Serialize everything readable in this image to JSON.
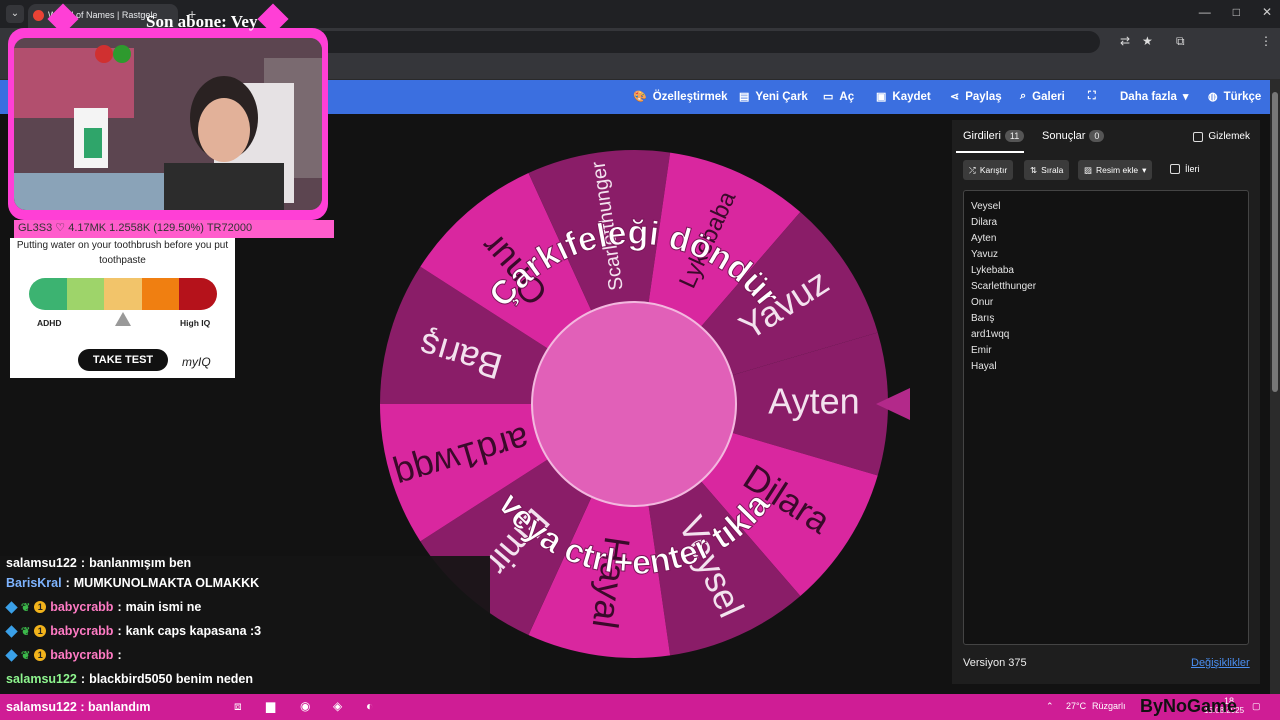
{
  "browser": {
    "tab_title": "Wheel of Names | Rastgele ad",
    "new_tab": "+"
  },
  "nav": {
    "items": [
      {
        "icon": "palette-icon",
        "label": "Özelleştirmek"
      },
      {
        "icon": "new-file-icon",
        "label": "Yeni Çark"
      },
      {
        "icon": "folder-open-icon",
        "label": "Aç"
      },
      {
        "icon": "save-icon",
        "label": "Kaydet"
      },
      {
        "icon": "share-icon",
        "label": "Paylaş"
      },
      {
        "icon": "search-icon",
        "label": "Galeri"
      },
      {
        "icon": "fullscreen-icon",
        "label": ""
      },
      {
        "icon": "chevron-down-icon",
        "label": "Daha fazla"
      },
      {
        "icon": "globe-icon",
        "label": "Türkçe"
      }
    ]
  },
  "wheel": {
    "prompt_line1": "Çarkıfeleği döndür",
    "prompt_line2": "veya ctrl+enter tıkla",
    "segments": [
      "Ayten",
      "Dilara",
      "Veysel",
      "Hayal",
      "Emir",
      "ard1wqq",
      "Barış",
      "Onur",
      "Scarletthunger",
      "Lykebaba",
      "Yavuz"
    ],
    "colors": {
      "dark": "#8a1d68",
      "light": "#d9279f",
      "center": "#e160b8",
      "pointer": "#b3298a"
    }
  },
  "panel": {
    "tabs": [
      {
        "label": "Girdileri",
        "count": "11"
      },
      {
        "label": "Sonuçlar",
        "count": "0"
      }
    ],
    "hide_label": "Gizlemek",
    "buttons": {
      "shuffle": "Karıştır",
      "sort": "Sırala",
      "add_image": "Resim ekle"
    },
    "advanced_label": "İleri",
    "entries": [
      "Veysel",
      "Dilara",
      "Ayten",
      "Yavuz",
      "Lykebaba",
      "Scarletthunger",
      "Onur",
      "Barış",
      "ard1wqq",
      "Emir",
      "Hayal"
    ],
    "version": "Versiyon 375",
    "changes_link": "Değişiklikler"
  },
  "overlay": {
    "cam_title": "Son abone: Vey",
    "bar_text": "GL3S3 ♡ 4.17MK  1.2558K   (129.50%)   TR72000"
  },
  "ad": {
    "text": "Putting water on your toothbrush before you put toothpaste",
    "low_label": "ADHD",
    "high_label": "High IQ",
    "button": "TAKE TEST",
    "brand": "myIQ",
    "meter_colors": [
      "#3cb371",
      "#9ed46a",
      "#f2c46a",
      "#f07f11",
      "#b5121b"
    ]
  },
  "chat": [
    {
      "user": "salamsu122",
      "user_color": "#ffffff",
      "msg": "banlanmışım ben",
      "badges": false
    },
    {
      "user": "BarisKral",
      "user_color": "#7eb4ff",
      "msg": "MUMKUNOLMAKTA OLMAKKK",
      "badges": false
    },
    {
      "user": "babycrabb",
      "user_color": "#ff7bc4",
      "msg": "main ismi ne",
      "badges": true
    },
    {
      "user": "babycrabb",
      "user_color": "#ff7bc4",
      "msg": "kank caps kapasana :3",
      "badges": true
    },
    {
      "user": "babycrabb",
      "user_color": "#ff7bc4",
      "msg": "",
      "badges": true
    },
    {
      "user": "salamsu122",
      "user_color": "#8ef58e",
      "msg": "blackbird5050 benim neden",
      "badges": false
    },
    {
      "user": "salamsu122",
      "user_color": "#8ef58e",
      "msg": "banlandım",
      "badges": false
    }
  ],
  "taskbar": {
    "weather": "27°C",
    "weather_label": "Rüzgarlı",
    "time": "18",
    "date": "15.08.2025",
    "logo": "ByNoGame"
  }
}
